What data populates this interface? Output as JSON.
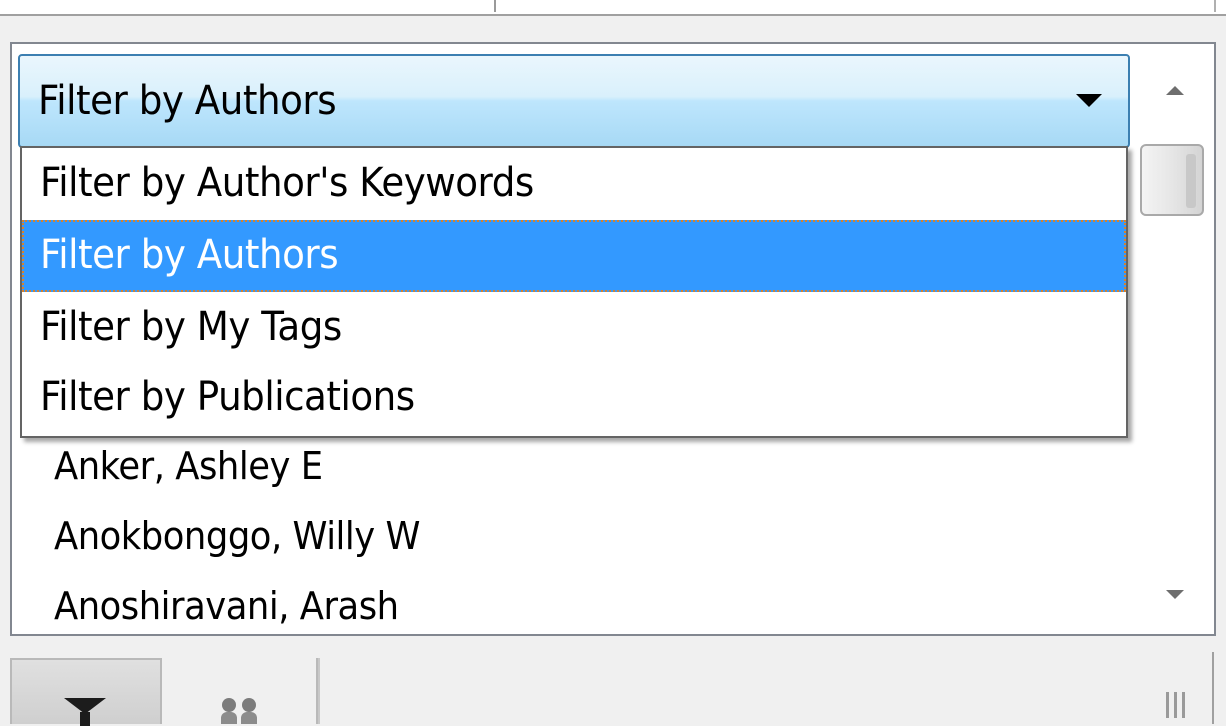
{
  "filter_combobox": {
    "selected_value": "Filter by Authors"
  },
  "dropdown": {
    "options": [
      {
        "label": "Filter by Author's Keywords",
        "selected": false
      },
      {
        "label": "Filter by Authors",
        "selected": true
      },
      {
        "label": "Filter by My Tags",
        "selected": false
      },
      {
        "label": "Filter by Publications",
        "selected": false
      }
    ]
  },
  "author_list": {
    "items": [
      "Anker, Ashley E",
      "Anokbonggo, Willy W",
      "Anoshiravani, Arash"
    ]
  },
  "scrollbar": {
    "up_icon": "triangle-up-icon",
    "down_icon": "triangle-down-icon"
  },
  "toolbar": {
    "filter_icon": "funnel-icon",
    "people_icon": "people-icon",
    "grip_icon": "resize-grip-icon"
  },
  "colors": {
    "selection": "#3399ff",
    "focus_border": "#d9822b",
    "combobox_border": "#3c7fb1"
  }
}
